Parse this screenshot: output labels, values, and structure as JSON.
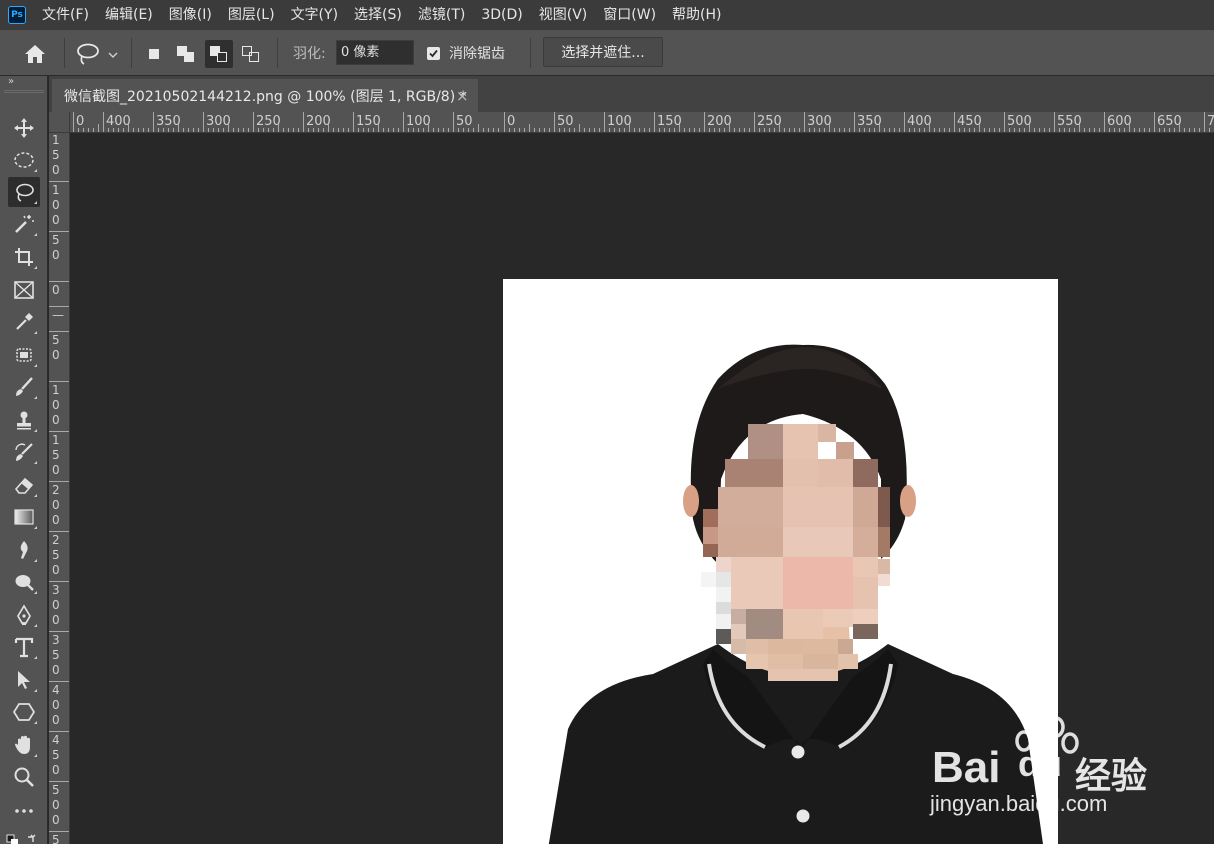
{
  "app": {
    "logo": "Ps"
  },
  "menu": [
    "文件(F)",
    "编辑(E)",
    "图像(I)",
    "图层(L)",
    "文字(Y)",
    "选择(S)",
    "滤镜(T)",
    "3D(D)",
    "视图(V)",
    "窗口(W)",
    "帮助(H)"
  ],
  "options": {
    "feather_label": "羽化:",
    "feather_value": "0 像素",
    "antialias_label": "消除锯齿",
    "antialias_checked": true,
    "select_mask_label": "选择并遮住..."
  },
  "document": {
    "tab_title": "微信截图_20210502144212.png @ 100% (图层 1, RGB/8) *",
    "close_glyph": "×"
  },
  "ruler": {
    "h_labels": [
      "0",
      "400",
      "350",
      "300",
      "250",
      "200",
      "150",
      "100",
      "50",
      "0",
      "50",
      "100",
      "150",
      "200",
      "250",
      "300",
      "350",
      "400",
      "450",
      "500",
      "550",
      "600",
      "650",
      "7"
    ],
    "v_labels": [
      "150",
      "100",
      "50",
      "0",
      "—",
      "50",
      "100",
      "150",
      "200",
      "250",
      "300",
      "350",
      "400",
      "450",
      "500",
      "5"
    ]
  },
  "tools": [
    "move-icon",
    "marquee-icon",
    "lasso-icon",
    "magic-wand-icon",
    "crop-icon",
    "frame-icon",
    "eyedropper-icon",
    "patch-icon",
    "brush-icon",
    "stamp-icon",
    "history-brush-icon",
    "eraser-icon",
    "gradient-icon",
    "blur-icon",
    "dodge-icon",
    "pen-icon",
    "type-icon",
    "path-select-icon",
    "shape-icon",
    "hand-icon",
    "zoom-icon",
    "more-icon"
  ],
  "watermark": {
    "brand_latin": "Bai",
    "brand_du": "du",
    "brand_cn": "经验",
    "url": "jingyan.baidu.com"
  },
  "colors": {
    "menubar": "#3b3b3b",
    "panel": "#535353",
    "canvas_bg": "#282828",
    "accent": "#31a8ff"
  }
}
